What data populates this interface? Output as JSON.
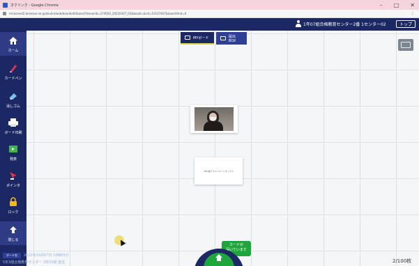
{
  "window": {
    "title": "オクリンク - Google Chrome",
    "controls": [
      "–",
      "□",
      "✕"
    ]
  },
  "browser": {
    "url": "miraiseed2.benesse.ne.jp/okulinkweb/boardedit/board?lessonId=274050_20220307_02&boxId=&rid=10147407&boardlimit=0",
    "menu": "⋮"
  },
  "header": {
    "user_label": "1年07組合格教育センター2番 1センター02",
    "top_button": "トップ"
  },
  "sidebar": {
    "items": [
      {
        "id": "home",
        "label": "ホーム",
        "icon": "home-icon",
        "color": "#ffffff"
      },
      {
        "id": "pen",
        "label": "カードペン",
        "icon": "pen-icon",
        "color": "#e0344b"
      },
      {
        "id": "eraser",
        "label": "消しゴム",
        "icon": "eraser-icon",
        "color": "#7ec3ee"
      },
      {
        "id": "print",
        "label": "ボード印刷",
        "icon": "printer-icon",
        "color": "#ffffff"
      },
      {
        "id": "present",
        "label": "発表",
        "icon": "presentation-icon",
        "color": "#3eb551"
      },
      {
        "id": "pointer",
        "label": "ポインタ",
        "icon": "pointer-icon",
        "color": "#e0344b"
      },
      {
        "id": "lock",
        "label": "ロック",
        "icon": "lock-icon",
        "color": "#f2b81e"
      },
      {
        "id": "close",
        "label": "閉じる",
        "icon": "up-arrow-icon",
        "color": "#ffffff"
      }
    ]
  },
  "tabs": [
    {
      "id": "my-board",
      "label": "MYボード",
      "icon": "board-icon"
    },
    {
      "id": "inbox",
      "label": "提出BOX",
      "icon": "inbox-icon"
    }
  ],
  "cards": {
    "text_card": "5年3組テキストカードボックス"
  },
  "notice": {
    "line1": "カードが",
    "line2": "届いています"
  },
  "status": {
    "card_count": "2/100枚"
  },
  "footer": {
    "tag": "ボード名",
    "time": "2022年03月07日 10時05分",
    "class": "5年3組合格教育センター 2年03組 担任"
  },
  "colors": {
    "navy": "#1c2863",
    "green": "#1ea53b",
    "accent": "#e8d23a"
  }
}
